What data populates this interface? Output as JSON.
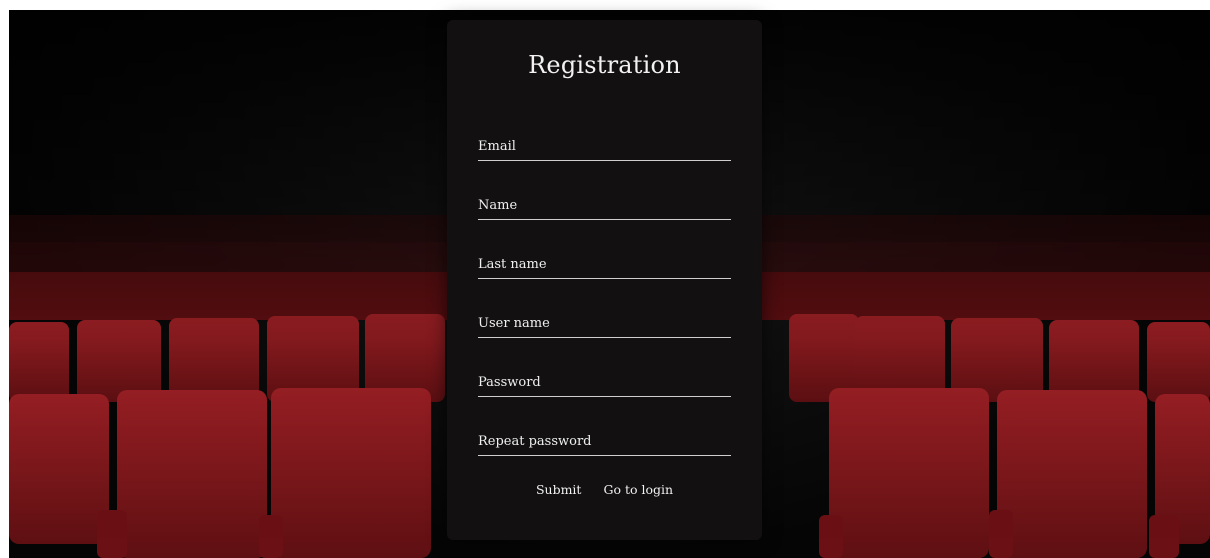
{
  "colors": {
    "panel_background": "#121011",
    "text": "#f2f2f2",
    "field_underline": "#cfcfcf",
    "seat_red": "#8e1a1e"
  },
  "background": {
    "scene": "cinema-seats"
  },
  "form": {
    "title": "Registration",
    "fields": [
      {
        "placeholder": "Email"
      },
      {
        "placeholder": "Name"
      },
      {
        "placeholder": "Last name"
      },
      {
        "placeholder": "User name"
      },
      {
        "placeholder": "Password"
      },
      {
        "placeholder": "Repeat password"
      }
    ],
    "submit_label": "Submit",
    "go_to_login_label": "Go to login"
  }
}
